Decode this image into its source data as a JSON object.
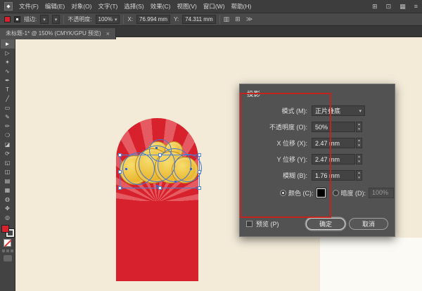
{
  "menubar": {
    "items": [
      "文件(F)",
      "编辑(E)",
      "对象(O)",
      "文字(T)",
      "选择(S)",
      "效果(C)",
      "视图(V)",
      "窗口(W)",
      "帮助(H)"
    ],
    "right_icons": [
      {
        "name": "document-arrange-icon",
        "glyph": "⊞"
      },
      {
        "name": "share-icon",
        "glyph": "⊡"
      },
      {
        "name": "workspace-icon",
        "glyph": "▦"
      },
      {
        "name": "overflow-icon",
        "glyph": "≡"
      }
    ]
  },
  "controlbar": {
    "stroke_label": "描边:",
    "stroke_caret": "▾",
    "brush_caret": "▾",
    "opacity_label": "不透明度:",
    "opacity_value": "100%",
    "opacity_caret": "▾",
    "x_label": "X:",
    "x_value": "76.994 mm",
    "y_label": "Y:",
    "y_value": "74.311 mm",
    "right_icons": [
      {
        "name": "align-panel-icon",
        "glyph": "▥"
      },
      {
        "name": "transform-panel-icon",
        "glyph": "⊞"
      },
      {
        "name": "more-options-icon",
        "glyph": "≫"
      }
    ]
  },
  "tabbar": {
    "title": "未标题-1* @ 150% (CMYK/GPU 预览)",
    "close_glyph": "×"
  },
  "toolbar": {
    "tools": [
      {
        "name": "selection-tool",
        "glyph": "►"
      },
      {
        "name": "direct-selection-tool",
        "glyph": "▷"
      },
      {
        "name": "magic-wand-tool",
        "glyph": "✶"
      },
      {
        "name": "lasso-tool",
        "glyph": "∿"
      },
      {
        "name": "pen-tool",
        "glyph": "✒"
      },
      {
        "name": "type-tool",
        "glyph": "T"
      },
      {
        "name": "line-segment-tool",
        "glyph": "╱"
      },
      {
        "name": "rectangle-tool",
        "glyph": "▭"
      },
      {
        "name": "paintbrush-tool",
        "glyph": "✎"
      },
      {
        "name": "pencil-tool",
        "glyph": "✏"
      },
      {
        "name": "blob-brush-tool",
        "glyph": "❍"
      },
      {
        "name": "eraser-tool",
        "glyph": "◪"
      },
      {
        "name": "rotate-tool",
        "glyph": "⟳"
      },
      {
        "name": "scale-tool",
        "glyph": "◱"
      },
      {
        "name": "shape-builder-tool",
        "glyph": "◫"
      },
      {
        "name": "gradient-tool",
        "glyph": "▤"
      },
      {
        "name": "mesh-tool",
        "glyph": "▦"
      },
      {
        "name": "eyedropper-tool",
        "glyph": "◍"
      },
      {
        "name": "hand-tool",
        "glyph": "✥"
      },
      {
        "name": "zoom-tool",
        "glyph": "◎"
      }
    ]
  },
  "dialog": {
    "title": "投影",
    "mode_label": "模式 (M):",
    "mode_value": "正片叠底",
    "mode_caret": "▾",
    "fields": [
      {
        "label": "不透明度 (O):",
        "value": "50%"
      },
      {
        "label": "X 位移 (X):",
        "value": "2.47 mm"
      },
      {
        "label": "Y 位移 (Y):",
        "value": "2.47 mm"
      },
      {
        "label": "模糊 (B):",
        "value": "1.76 mm"
      }
    ],
    "stepper_up": "▴",
    "stepper_down": "▾",
    "color_label": "颜色 (C):",
    "darkness_label": "暗度 (D):",
    "darkness_value": "100%",
    "preview_label": "预览 (P)",
    "ok_label": "确定",
    "cancel_label": "取消"
  },
  "colors": {
    "ui_panel": "#525252",
    "canvas_bg": "#f3ead8",
    "artwork_red": "#d7212d",
    "coin_gold": "#ecba35",
    "selection_blue": "#4677cf",
    "annotation_red": "#c3241e"
  }
}
